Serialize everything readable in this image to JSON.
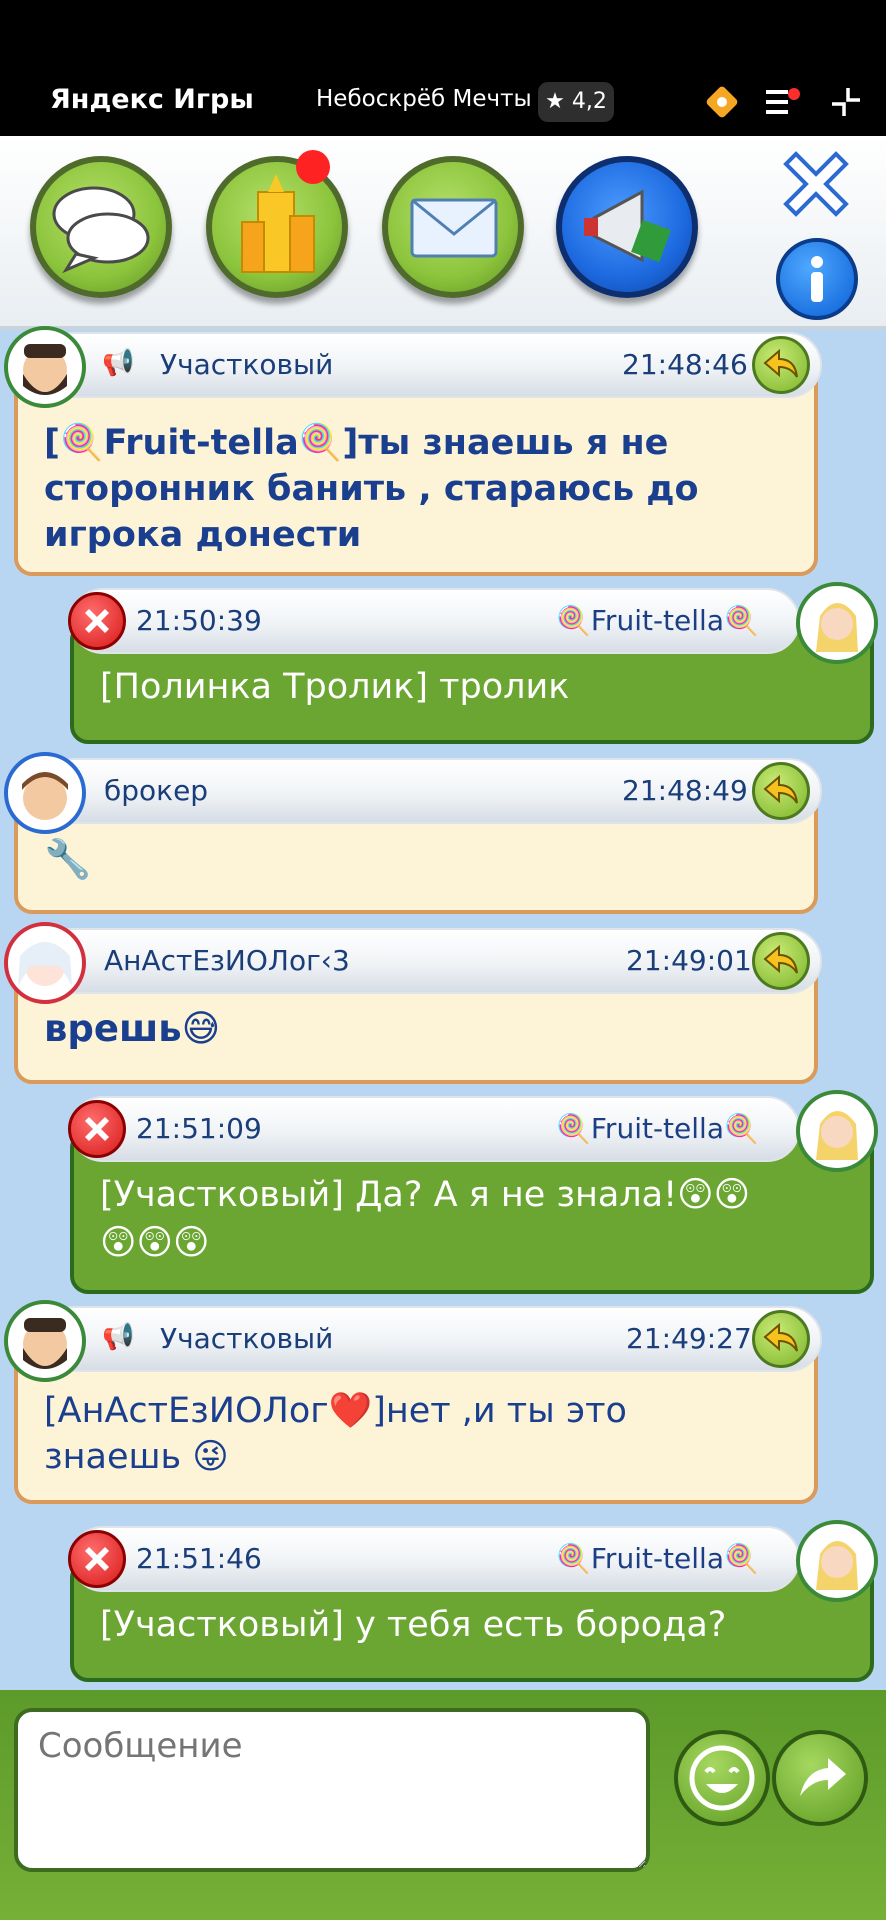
{
  "topbar": {
    "brand": "Яндекс Игры",
    "game_title": "Небоскрёб Мечты",
    "rating": "★ 4,2"
  },
  "toolbar": {
    "buttons": [
      "chat-bubbles-icon",
      "skyscraper-icon",
      "envelope-icon",
      "megaphone-icon"
    ]
  },
  "messages": [
    {
      "author": "Участковый",
      "time": "21:48:46",
      "text_line1": "[🍭Fruit-tella🍭]ты знаешь я не",
      "text_line2": "сторонник банить , стараюсь до",
      "text_line3": "игрока донести"
    },
    {
      "author": "🍭Fruit-tella🍭",
      "time": "21:50:39",
      "text": "[Полинка Тролик] тролик"
    },
    {
      "author": "брокер",
      "time": "21:48:49",
      "text": "🔧"
    },
    {
      "author": "АнАстЕзИОЛог‹3",
      "time": "21:49:01",
      "text": "врешь😅"
    },
    {
      "author": "🍭Fruit-tella🍭",
      "time": "21:51:09",
      "text_line1": "[Участковый] Да? А я не знала!😲😲",
      "text_line2": "😲😲😲"
    },
    {
      "author": "Участковый",
      "time": "21:49:27",
      "text_line1": " [АнАстЕзИОЛог❤️]нет ,и ты это",
      "text_line2": "знаешь 😜"
    },
    {
      "author": "🍭Fruit-tella🍭",
      "time": "21:51:46",
      "text": "[Участковый] у тебя есть борода?"
    }
  ],
  "composer": {
    "placeholder": "Сообщение"
  }
}
